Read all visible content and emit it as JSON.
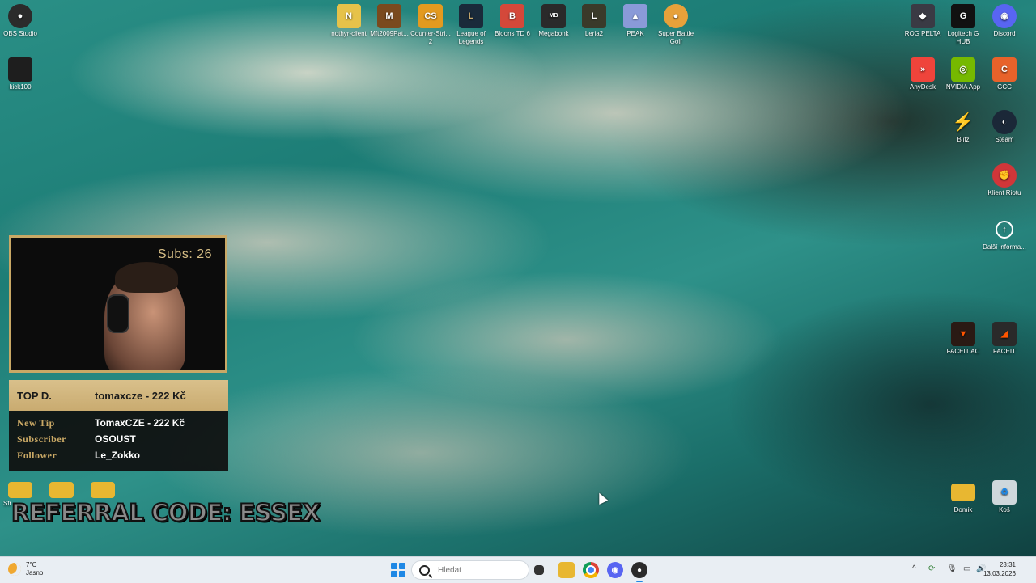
{
  "desktop": {
    "icons_left": [
      {
        "label": "OBS Studio",
        "icon": "obs-icon",
        "color": "#2b2b2b"
      },
      {
        "label": "kick100",
        "icon": "kick-icon",
        "color": "#1e1e1e"
      }
    ],
    "icons_top": [
      {
        "label": "nothyr-client",
        "icon": "nothyr-icon",
        "color": "#e6c24a"
      },
      {
        "label": "Mft2009Pat...",
        "icon": "mafia-icon",
        "color": "#7a4a1e"
      },
      {
        "label": "Counter-Stri... 2",
        "icon": "counter-strike-icon",
        "color": "#e39a1f"
      },
      {
        "label": "League of Legends",
        "icon": "league-icon",
        "color": "#1a2a3a"
      },
      {
        "label": "Bloons TD 6",
        "icon": "bloons-icon",
        "color": "#d4483a"
      },
      {
        "label": "Megabonk",
        "icon": "megabonk-icon",
        "color": "#2a2a2a"
      },
      {
        "label": "Leria2",
        "icon": "leria-icon",
        "color": "#3a3a2a"
      },
      {
        "label": "PEAK",
        "icon": "peak-icon",
        "color": "#8a9ad8"
      },
      {
        "label": "Super Battle Golf",
        "icon": "golf-icon",
        "color": "#e7a13a"
      }
    ],
    "icons_right": [
      {
        "label": "ROG PELTA",
        "icon": "rog-icon",
        "color": "#3a3a44"
      },
      {
        "label": "Logitech G HUB",
        "icon": "logitech-icon",
        "color": "#111111"
      },
      {
        "label": "Discord",
        "icon": "discord-icon",
        "color": "#5865f2"
      },
      {
        "label": "AnyDesk",
        "icon": "anydesk-icon",
        "color": "#ef443b"
      },
      {
        "label": "NVIDIA App",
        "icon": "nvidia-icon",
        "color": "#76b900"
      },
      {
        "label": "GCC",
        "icon": "gcc-icon",
        "color": "#e8622a"
      },
      {
        "label": "Blitz",
        "icon": "blitz-icon",
        "color": "#e23a4a"
      },
      {
        "label": "Steam",
        "icon": "steam-icon",
        "color": "#1b2838"
      },
      {
        "label": "Klient Riotu",
        "icon": "riot-icon",
        "color": "#d13639"
      },
      {
        "label": "Další informa...",
        "icon": "info-icon",
        "color": "#222222"
      },
      {
        "label": "FACEIT AC",
        "icon": "faceit-ac-icon",
        "color": "#2a1a14"
      },
      {
        "label": "FACEIT",
        "icon": "faceit-icon",
        "color": "#ff5500"
      }
    ],
    "icons_bottom_right": [
      {
        "label": "Domik",
        "icon": "folder-icon",
        "color": "#e8b731"
      },
      {
        "label": "Koš",
        "icon": "recycle-bin-icon",
        "color": "#cfd8dc"
      }
    ],
    "icons_bottom_left_partial": "Str"
  },
  "stream_overlay": {
    "subs": "Subs: 26",
    "top_donation": {
      "key": "TOP D.",
      "value": "tomaxcze - 222 Kč"
    },
    "events": [
      {
        "key": "New Tip",
        "value": "TomaxCZE - 222 Kč"
      },
      {
        "key": "Subscriber",
        "value": "OSOUST"
      },
      {
        "key": "Follower",
        "value": "Le_Zokko"
      }
    ],
    "referral": "REFERRAL CODE: ESSEX"
  },
  "taskbar": {
    "weather": {
      "temp": "7°C",
      "condition": "Jasno"
    },
    "search_placeholder": "Hledat",
    "apps": [
      "task-view-icon",
      "file-explorer-icon",
      "chrome-icon",
      "discord-icon",
      "obs-icon"
    ],
    "clock": {
      "time": "23:31",
      "date": "13.03.2026"
    }
  }
}
